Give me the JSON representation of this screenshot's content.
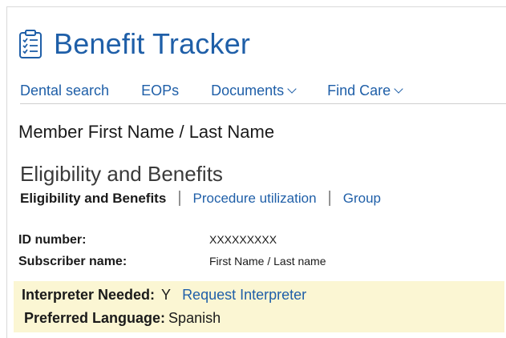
{
  "app": {
    "title": "Benefit Tracker",
    "icon": "checklist-icon",
    "accent_color": "#1f5fa8"
  },
  "nav": {
    "items": [
      {
        "label": "Dental search",
        "has_dropdown": false
      },
      {
        "label": "EOPs",
        "has_dropdown": false
      },
      {
        "label": "Documents",
        "has_dropdown": true
      },
      {
        "label": "Find Care",
        "has_dropdown": true
      }
    ]
  },
  "member": {
    "name": "Member First Name / Last Name"
  },
  "section": {
    "title": "Eligibility and Benefits",
    "tabs": [
      {
        "label": "Eligibility and Benefits",
        "active": true
      },
      {
        "label": "Procedure utilization",
        "active": false
      },
      {
        "label": "Group",
        "active": false
      }
    ]
  },
  "details": {
    "id_label": "ID number:",
    "id_value": "XXXXXXXXX",
    "subscriber_label": "Subscriber name:",
    "subscriber_value": "First Name / Last name"
  },
  "interpreter": {
    "needed_label": "Interpreter Needed:",
    "needed_value": "Y",
    "request_link": "Request Interpreter",
    "language_label": "Preferred Language:",
    "language_value": "Spanish",
    "highlight_color": "#fbf6d3"
  }
}
